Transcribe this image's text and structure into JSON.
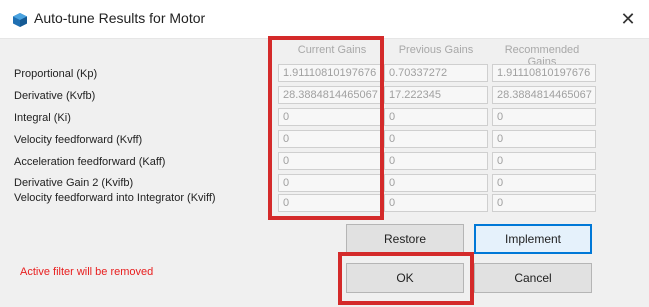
{
  "window": {
    "title": "Auto-tune Results for Motor",
    "close_glyph": "✕",
    "icon_color": "#1f6fb2"
  },
  "columns": {
    "current": "Current Gains",
    "previous": "Previous Gains",
    "recommended": "Recommended Gains"
  },
  "rows": [
    {
      "label": "Proportional (Kp)",
      "current": "1.91110810197676",
      "previous": "0.70337272",
      "recommended": "1.91110810197676"
    },
    {
      "label": "Derivative (Kvfb)",
      "current": "28.3884814465067",
      "previous": "17.222345",
      "recommended": "28.3884814465067"
    },
    {
      "label": "Integral (Ki)",
      "current": "0",
      "previous": "0",
      "recommended": "0"
    },
    {
      "label": "Velocity feedforward (Kvff)",
      "current": "0",
      "previous": "0",
      "recommended": "0"
    },
    {
      "label": "Acceleration feedforward (Kaff)",
      "current": "0",
      "previous": "0",
      "recommended": "0"
    },
    {
      "label": "Derivative Gain 2 (Kvifb)",
      "current": "0",
      "previous": "0",
      "recommended": "0"
    },
    {
      "label": "Velocity feedforward into Integrator (Kviff)",
      "current": "0",
      "previous": "0",
      "recommended": "0"
    }
  ],
  "buttons": {
    "restore": "Restore",
    "implement": "Implement",
    "ok": "OK",
    "cancel": "Cancel"
  },
  "status_text": "Active filter will be removed",
  "colors": {
    "highlight": "#d42a2a",
    "status": "#e81e1e",
    "primary_border": "#0078d7"
  }
}
